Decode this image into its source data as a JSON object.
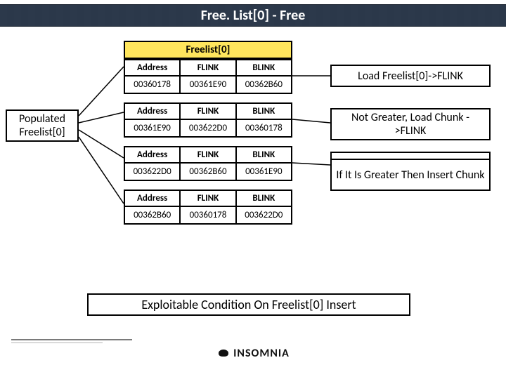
{
  "title": "Free. List[0] - Free",
  "freelist_header": "Freelist[0]",
  "populated_label": "Populated Freelist[0]",
  "columns": {
    "address": "Address",
    "flink": "FLINK",
    "blink": "BLINK"
  },
  "tables": [
    {
      "address": "00360178",
      "flink": "00361E90",
      "blink": "00362B60"
    },
    {
      "address": "00361E90",
      "flink": "003622D0",
      "blink": "00360178"
    },
    {
      "address": "003622D0",
      "flink": "00362B60",
      "blink": "00361E90"
    },
    {
      "address": "00362B60",
      "flink": "00360178",
      "blink": "003622D0"
    }
  ],
  "right_boxes": {
    "step1": "Load Freelist[0]->FLINK",
    "step2": "Not Greater, Load Chunk ->FLINK",
    "step3": "If It Is Greater Then Insert Chunk"
  },
  "bottom_label": "Exploitable Condition On Freelist[0] Insert",
  "footer": "INSOMNIA"
}
